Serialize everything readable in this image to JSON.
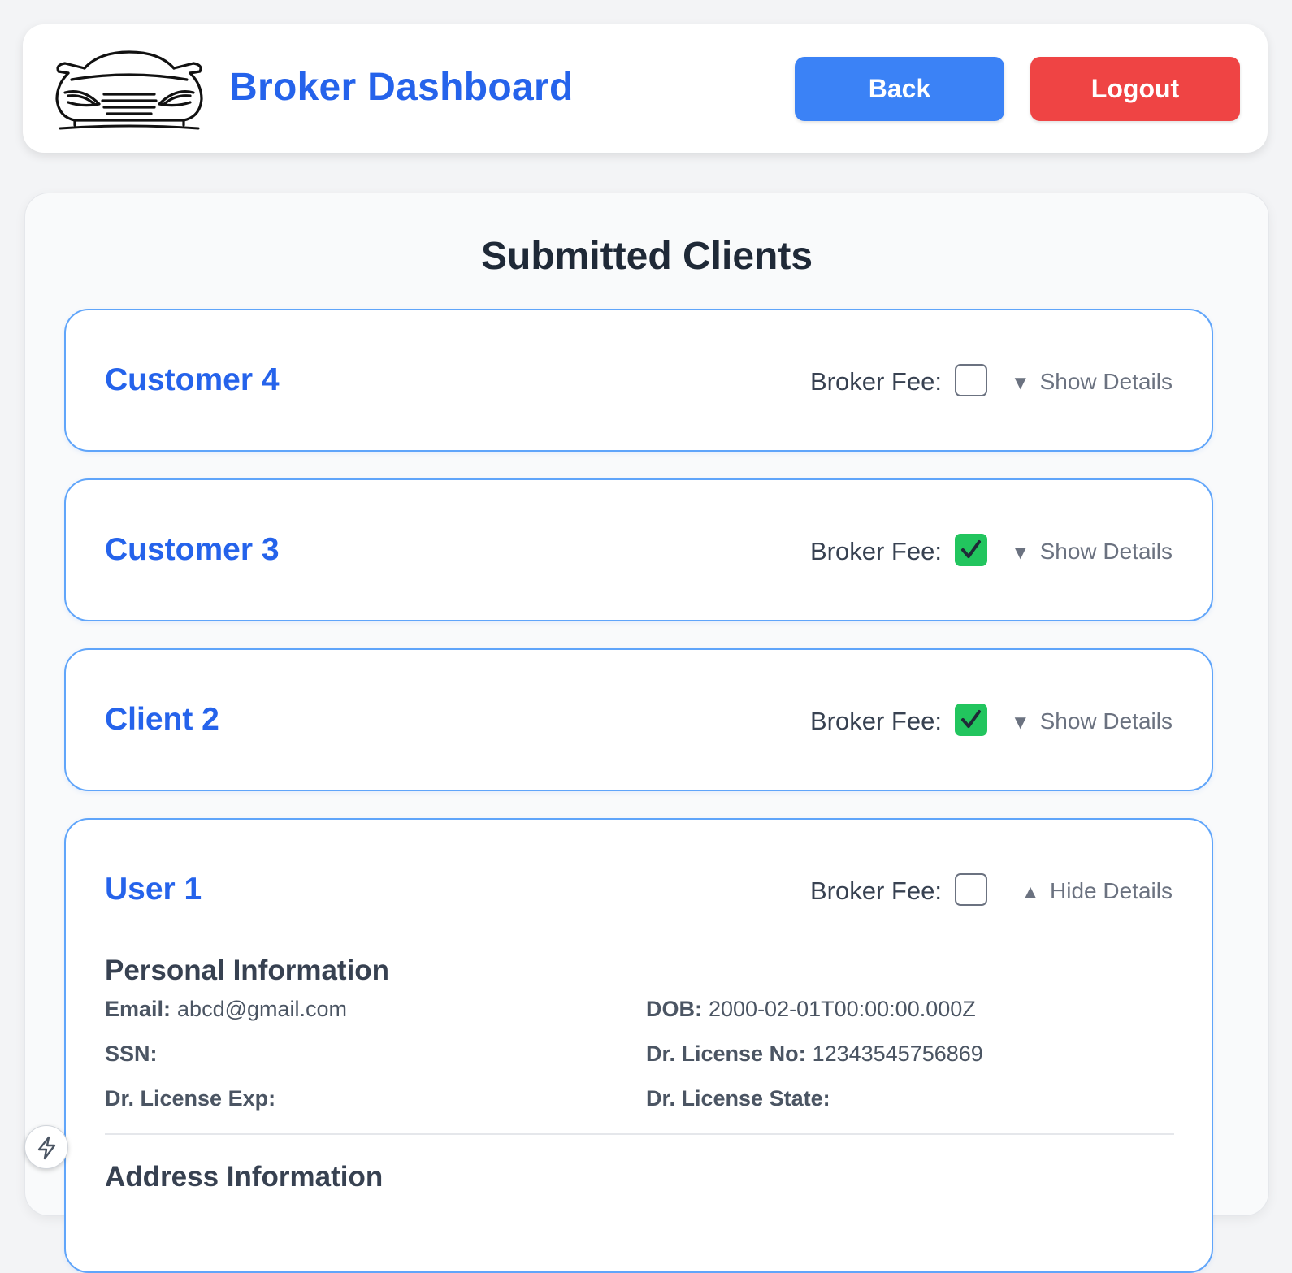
{
  "header": {
    "title": "Broker Dashboard",
    "logo_icon": "car-logo-icon",
    "back_label": "Back",
    "logout_label": "Logout",
    "colors": {
      "title": "#2563eb",
      "back": "#3b82f6",
      "logout": "#ef4444"
    }
  },
  "panel": {
    "title": "Submitted Clients"
  },
  "clients": [
    {
      "name": "Customer 4",
      "broker_fee_label": "Broker Fee:",
      "broker_fee_checked": false,
      "toggle_arrow": "▼",
      "toggle_label": "Show Details"
    },
    {
      "name": "Customer 3",
      "broker_fee_label": "Broker Fee:",
      "broker_fee_checked": true,
      "toggle_arrow": "▼",
      "toggle_label": "Show Details"
    },
    {
      "name": "Client 2",
      "broker_fee_label": "Broker Fee:",
      "broker_fee_checked": true,
      "toggle_arrow": "▼",
      "toggle_label": "Show Details"
    },
    {
      "name": "User 1",
      "broker_fee_label": "Broker Fee:",
      "broker_fee_checked": false,
      "toggle_arrow": "▲",
      "toggle_label": "Hide Details",
      "details": {
        "personal_title": "Personal Information",
        "email_label": "Email:",
        "email": "abcd@gmail.com",
        "dob_label": "DOB:",
        "dob": "2000-02-01T00:00:00.000Z",
        "ssn_label": "SSN:",
        "ssn": "",
        "license_no_label": "Dr. License No:",
        "license_no": "12343545756869",
        "license_exp_label": "Dr. License Exp:",
        "license_exp": "",
        "license_state_label": "Dr. License State:",
        "license_state": "",
        "next_section_title": "Address Information"
      }
    }
  ],
  "fab": {
    "icon": "lightning-icon"
  }
}
